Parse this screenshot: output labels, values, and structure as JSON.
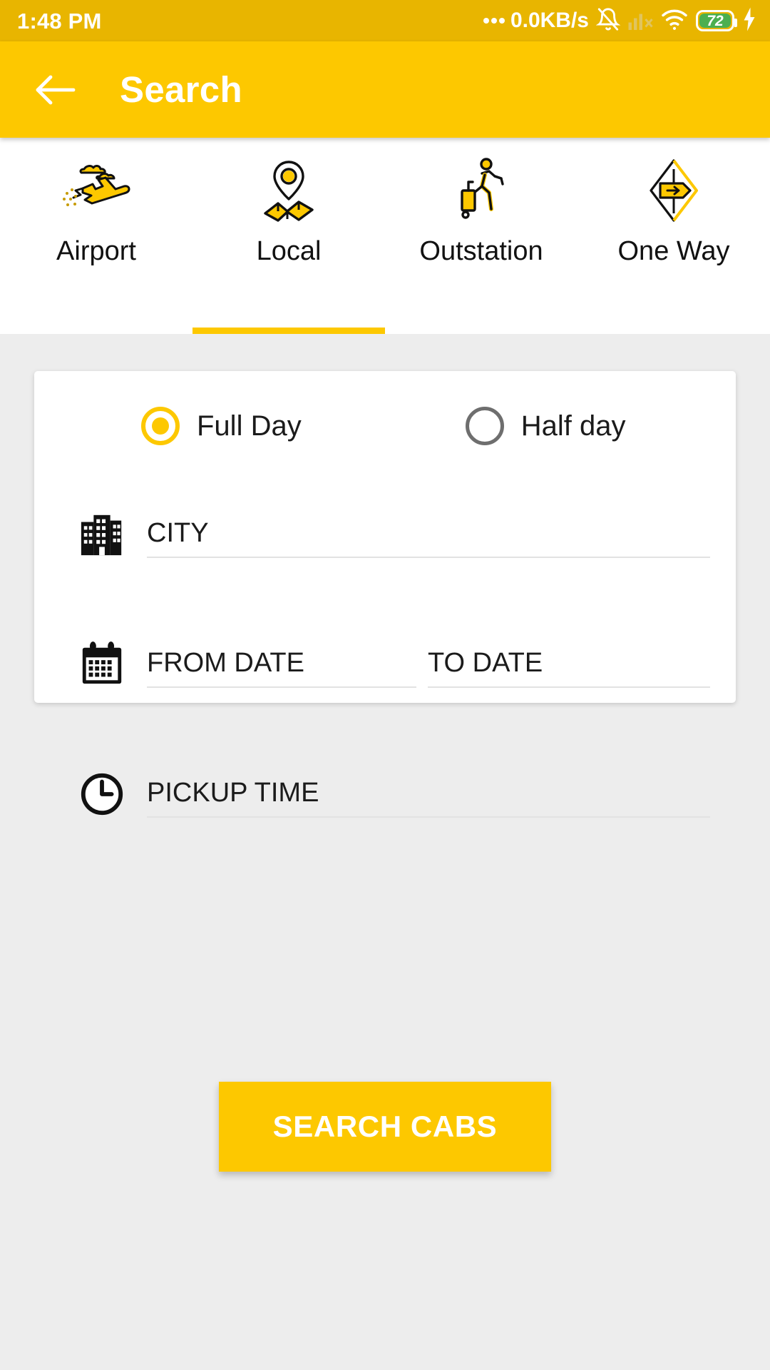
{
  "statusbar": {
    "time": "1:48 PM",
    "network_speed": "0.0KB/s",
    "battery_level": "72",
    "icons": {
      "overflow": "more-dots-icon",
      "mute": "bell-muted-icon",
      "signal": "signal-off-icon",
      "wifi": "wifi-icon",
      "battery": "battery-icon",
      "charging": "charging-bolt-icon"
    }
  },
  "appbar": {
    "back_icon": "back-arrow-icon",
    "title": "Search"
  },
  "tabs": {
    "active_index": 1,
    "items": [
      {
        "label": "Airport",
        "icon": "airplane-icon"
      },
      {
        "label": "Local",
        "icon": "map-pin-icon"
      },
      {
        "label": "Outstation",
        "icon": "traveler-luggage-icon"
      },
      {
        "label": "One Way",
        "icon": "one-way-sign-icon"
      }
    ]
  },
  "form": {
    "duration": {
      "selected": "Full Day",
      "options": [
        {
          "label": "Full Day",
          "selected": true
        },
        {
          "label": "Half day",
          "selected": false
        }
      ]
    },
    "city": {
      "icon": "building-icon",
      "placeholder": "CITY",
      "value": ""
    },
    "dates": {
      "icon": "calendar-icon",
      "from": {
        "placeholder": "FROM DATE",
        "value": ""
      },
      "to": {
        "placeholder": "TO DATE",
        "value": ""
      }
    },
    "pickup_time": {
      "icon": "clock-icon",
      "placeholder": "PICKUP TIME",
      "value": ""
    }
  },
  "cta": {
    "label": "SEARCH CABS"
  },
  "colors": {
    "brand_yellow": "#fdc800",
    "status_yellow": "#e8b500",
    "page_bg": "#ededed",
    "card_bg": "#ffffff",
    "text_primary": "#1b1b1b",
    "radio_off": "#6e6e6e",
    "battery_green": "#4caf50"
  }
}
